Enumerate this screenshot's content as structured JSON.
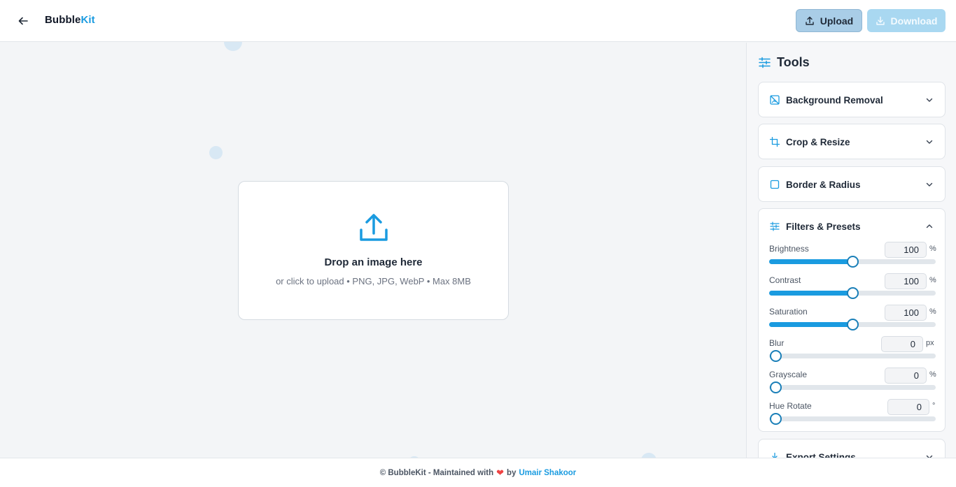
{
  "header": {
    "brand_part1": "Bubble",
    "brand_part2": "Kit",
    "upload_label": "Upload",
    "download_label": "Download"
  },
  "dropzone": {
    "title": "Drop an image here",
    "subtitle": "or click to upload • PNG, JPG, WebP • Max 8MB"
  },
  "sidebar": {
    "title": "Tools",
    "panels": [
      {
        "label": "Background Removal",
        "icon": "image-off-icon",
        "expanded": false
      },
      {
        "label": "Crop & Resize",
        "icon": "crop-icon",
        "expanded": false
      },
      {
        "label": "Border & Radius",
        "icon": "square-icon",
        "expanded": false
      },
      {
        "label": "Filters & Presets",
        "icon": "sliders-icon",
        "expanded": true
      },
      {
        "label": "Export Settings",
        "icon": "download-icon",
        "expanded": false
      }
    ],
    "filters": [
      {
        "label": "Brightness",
        "value": "100",
        "unit": "%",
        "fraction": 0.5
      },
      {
        "label": "Contrast",
        "value": "100",
        "unit": "%",
        "fraction": 0.5
      },
      {
        "label": "Saturation",
        "value": "100",
        "unit": "%",
        "fraction": 0.5
      },
      {
        "label": "Blur",
        "value": "0",
        "unit": "px",
        "fraction": 0
      },
      {
        "label": "Grayscale",
        "value": "0",
        "unit": "%",
        "fraction": 0
      },
      {
        "label": "Hue Rotate",
        "value": "0",
        "unit": "°",
        "fraction": 0
      }
    ]
  },
  "footer": {
    "prefix": "© BubbleKit - Maintained with",
    "by": "by",
    "author": "Umair Shakoor"
  },
  "colors": {
    "accent": "#1a9be0",
    "heart": "#ef4444"
  }
}
